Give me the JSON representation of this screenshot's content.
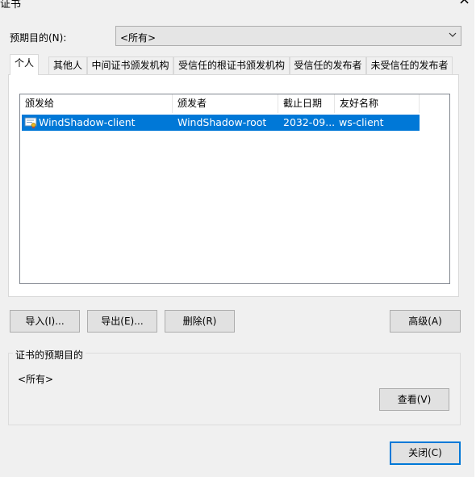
{
  "window": {
    "title": "证书",
    "close_glyph": "×"
  },
  "purpose": {
    "label": "预期目的(N):",
    "value": "<所有>"
  },
  "tabs": [
    {
      "label": "个人"
    },
    {
      "label": "其他人"
    },
    {
      "label": "中间证书颁发机构"
    },
    {
      "label": "受信任的根证书颁发机构"
    },
    {
      "label": "受信任的发布者"
    },
    {
      "label": "未受信任的发布者"
    }
  ],
  "list": {
    "columns": [
      "颁发给",
      "颁发者",
      "截止日期",
      "友好名称"
    ],
    "rows": [
      {
        "issued_to": "WindShadow-client",
        "issued_by": "WindShadow-root",
        "expires": "2032-09...",
        "friendly_name": "ws-client",
        "icon": "certificate-icon",
        "selected": true
      }
    ]
  },
  "buttons": {
    "import": "导入(I)...",
    "export": "导出(E)...",
    "remove": "删除(R)",
    "advanced": "高级(A)",
    "view": "查看(V)",
    "close": "关闭(C)"
  },
  "intended_purposes": {
    "title": "证书的预期目的",
    "value": "<所有>"
  },
  "colors": {
    "selection": "#0078d7",
    "accent_border": "#0078d7",
    "background": "#f0f0f0"
  }
}
